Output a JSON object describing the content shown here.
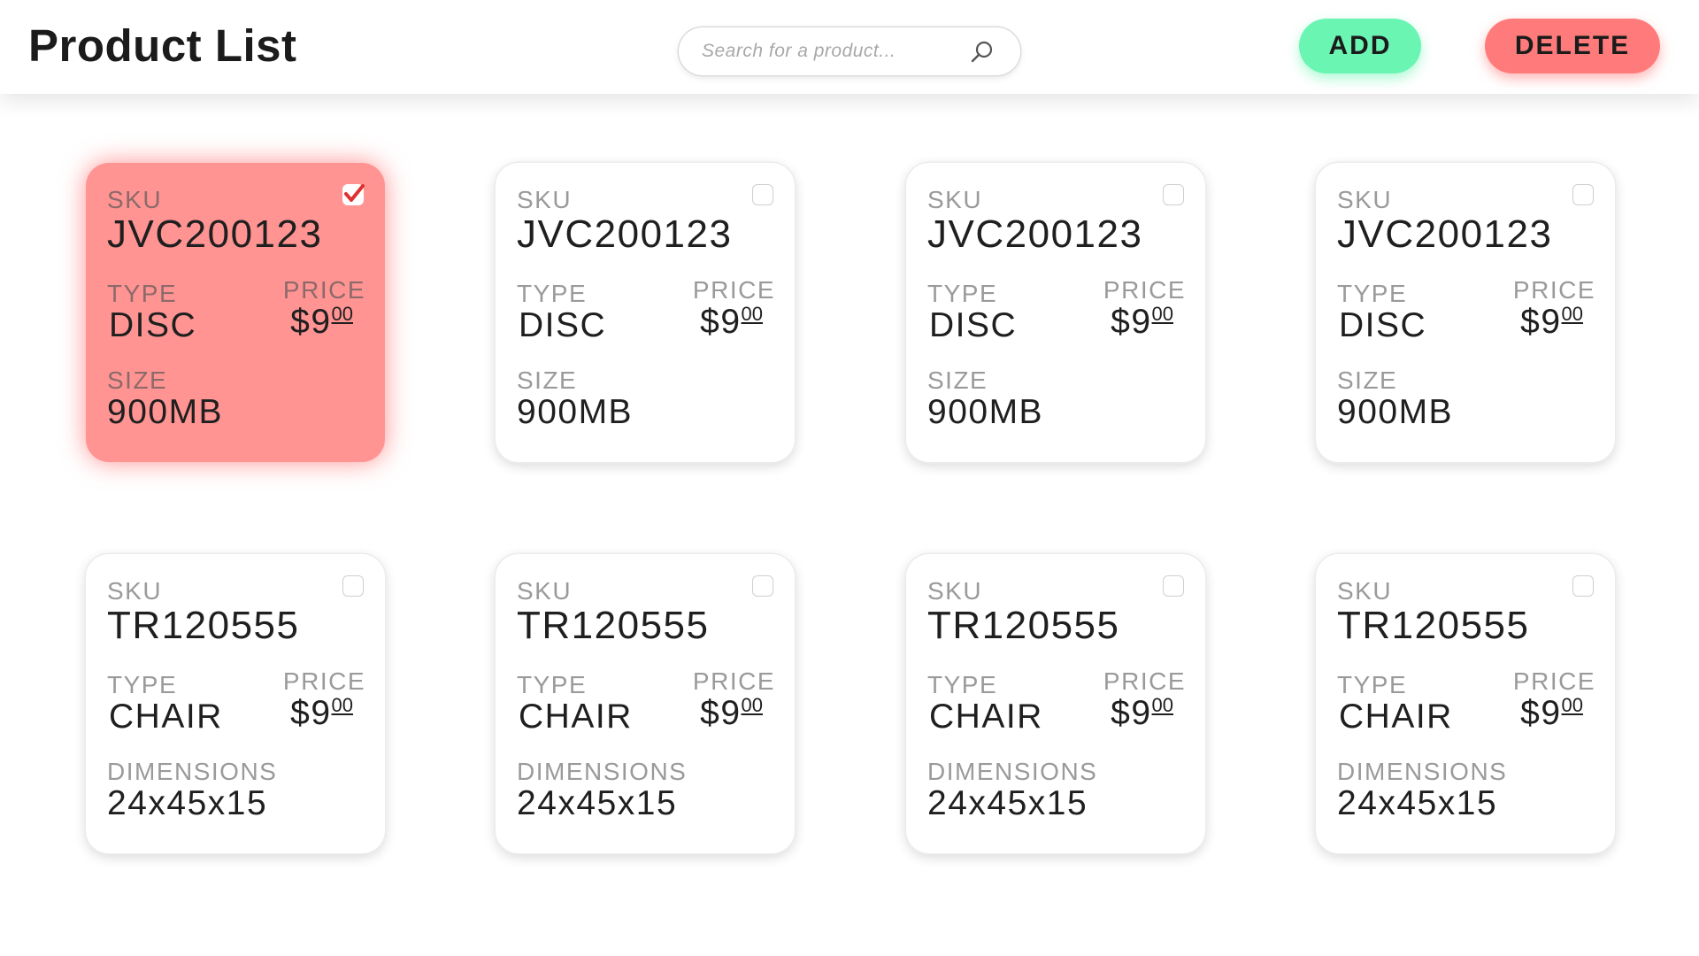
{
  "header": {
    "title": "Product List",
    "search_placeholder": "Search for a product...",
    "add_label": "ADD",
    "delete_label": "DELETE"
  },
  "colors": {
    "add": "#6bf5b3",
    "delete": "#ff7b7b",
    "selected_card": "#ff9493"
  },
  "products": [
    {
      "sku_label": "SKU",
      "sku": "JVC200123",
      "type_label": "TYPE",
      "type": "DISC",
      "price_label": "PRICE",
      "price_whole": "$9",
      "price_cents": "00",
      "attr_label": "SIZE",
      "attr_value": "900MB",
      "selected": true
    },
    {
      "sku_label": "SKU",
      "sku": "JVC200123",
      "type_label": "TYPE",
      "type": "DISC",
      "price_label": "PRICE",
      "price_whole": "$9",
      "price_cents": "00",
      "attr_label": "SIZE",
      "attr_value": "900MB",
      "selected": false
    },
    {
      "sku_label": "SKU",
      "sku": "JVC200123",
      "type_label": "TYPE",
      "type": "DISC",
      "price_label": "PRICE",
      "price_whole": "$9",
      "price_cents": "00",
      "attr_label": "SIZE",
      "attr_value": "900MB",
      "selected": false
    },
    {
      "sku_label": "SKU",
      "sku": "JVC200123",
      "type_label": "TYPE",
      "type": "DISC",
      "price_label": "PRICE",
      "price_whole": "$9",
      "price_cents": "00",
      "attr_label": "SIZE",
      "attr_value": "900MB",
      "selected": false
    },
    {
      "sku_label": "SKU",
      "sku": "TR120555",
      "type_label": "TYPE",
      "type": "CHAIR",
      "price_label": "PRICE",
      "price_whole": "$9",
      "price_cents": "00",
      "attr_label": "DIMENSIONS",
      "attr_value": "24x45x15",
      "selected": false
    },
    {
      "sku_label": "SKU",
      "sku": "TR120555",
      "type_label": "TYPE",
      "type": "CHAIR",
      "price_label": "PRICE",
      "price_whole": "$9",
      "price_cents": "00",
      "attr_label": "DIMENSIONS",
      "attr_value": "24x45x15",
      "selected": false
    },
    {
      "sku_label": "SKU",
      "sku": "TR120555",
      "type_label": "TYPE",
      "type": "CHAIR",
      "price_label": "PRICE",
      "price_whole": "$9",
      "price_cents": "00",
      "attr_label": "DIMENSIONS",
      "attr_value": "24x45x15",
      "selected": false
    },
    {
      "sku_label": "SKU",
      "sku": "TR120555",
      "type_label": "TYPE",
      "type": "CHAIR",
      "price_label": "PRICE",
      "price_whole": "$9",
      "price_cents": "00",
      "attr_label": "DIMENSIONS",
      "attr_value": "24x45x15",
      "selected": false
    }
  ]
}
